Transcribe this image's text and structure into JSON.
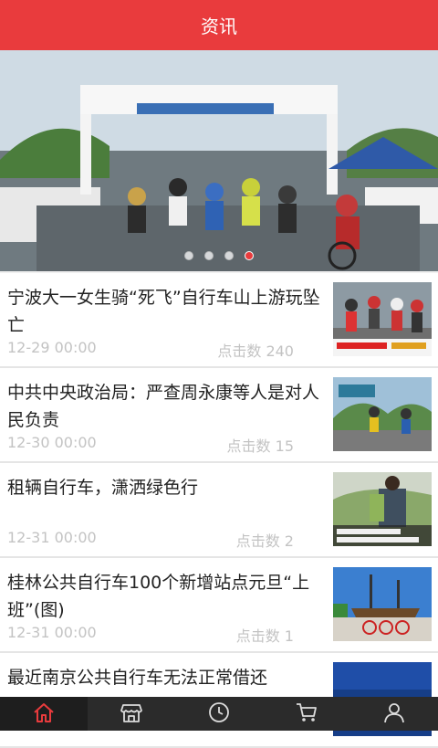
{
  "header": {
    "title": "资讯"
  },
  "banner": {
    "slide_count": 4,
    "active_slide": 4,
    "accent": "#e93b3d"
  },
  "news": [
    {
      "title": "宁波大一女生骑“死飞”自行车山上游玩坠亡",
      "date": "12-29 00:00",
      "clicks": "点击数 240"
    },
    {
      "title": "中共中央政治局：严查周永康等人是对人民负责",
      "date": "12-30 00:00",
      "clicks": "点击数 15"
    },
    {
      "title": "租辆自行车，潇洒绿色行",
      "date": "12-31 00:00",
      "clicks": "点击数 2"
    },
    {
      "title": "桂林公共自行车100个新增站点元旦“上班”(图)",
      "date": "12-31 00:00",
      "clicks": "点击数 1"
    },
    {
      "title": "最近南京公共自行车无法正常借还",
      "date": "",
      "clicks": ""
    }
  ],
  "tabbar": {
    "items": [
      {
        "icon": "home-icon",
        "active": true
      },
      {
        "icon": "store-icon",
        "active": false
      },
      {
        "icon": "clock-icon",
        "active": false
      },
      {
        "icon": "cart-icon",
        "active": false
      },
      {
        "icon": "user-icon",
        "active": false
      }
    ]
  },
  "colors": {
    "header_bg": "#e93b3d",
    "tabbar_bg": "#2b2b2b",
    "active_icon": "#e93b3d"
  }
}
